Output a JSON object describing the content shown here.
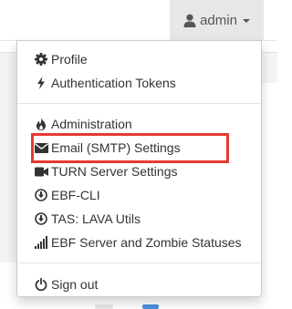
{
  "navbar": {
    "user_label": "admin"
  },
  "menu": {
    "items": [
      {
        "label": "Profile",
        "icon": "cog-icon"
      },
      {
        "label": "Authentication Tokens",
        "icon": "bolt-icon"
      },
      {
        "label": "Administration",
        "icon": "fire-icon"
      },
      {
        "label": "Email (SMTP) Settings",
        "icon": "envelope-icon"
      },
      {
        "label": "TURN Server Settings",
        "icon": "video-camera-icon"
      },
      {
        "label": "EBF-CLI",
        "icon": "download-circle-icon"
      },
      {
        "label": "TAS: LAVA Utils",
        "icon": "download-circle-icon"
      },
      {
        "label": "EBF Server and Zombie Statuses",
        "icon": "signal-bars-icon"
      },
      {
        "label": "Sign out",
        "icon": "power-icon"
      }
    ],
    "highlighted_item": "Email (SMTP) Settings"
  },
  "colors": {
    "highlight": "#e53935",
    "toggle_bg": "#e7e7e7",
    "text": "#333333"
  }
}
